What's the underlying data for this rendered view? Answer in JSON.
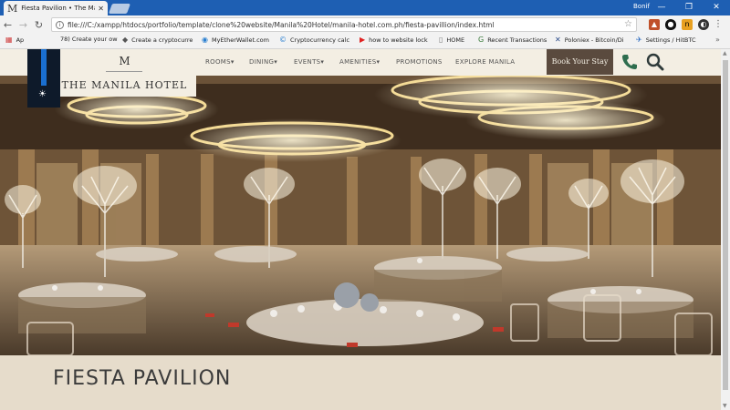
{
  "browser": {
    "tab_title": "Fiesta Pavilion • The Mani",
    "tab_favicon": "M",
    "profile_name": "Bonif",
    "url": "file:///C:/xampp/htdocs/portfolio/template/clone%20website/Manila%20Hotel/manila-hotel.com.ph/fiesta-pavillion/index.html",
    "bookmarks": [
      {
        "icon": "apps-grid-icon",
        "label": "Ap"
      },
      {
        "icon": "page-icon",
        "label": "78) Create your ow"
      },
      {
        "icon": "ethereum-icon",
        "label": "Create a cryptocurre"
      },
      {
        "icon": "myetherwallet-icon",
        "label": "MyEtherWallet.com"
      },
      {
        "icon": "calculator-icon",
        "label": "Cryptocurrency calc"
      },
      {
        "icon": "youtube-icon",
        "label": "how to website lock"
      },
      {
        "icon": "page-icon",
        "label": "HOME"
      },
      {
        "icon": "google-icon",
        "label": "Recent Transactions"
      },
      {
        "icon": "poloniex-icon",
        "label": "Poloniex - Bitcoin/Di"
      },
      {
        "icon": "hitbtc-icon",
        "label": "Settings / HitBTC"
      }
    ]
  },
  "site": {
    "logo_letter": "M",
    "logo_name": "THE MANILA HOTEL",
    "nav": [
      {
        "label": "ROOMS",
        "has_dropdown": true
      },
      {
        "label": "DINING",
        "has_dropdown": true
      },
      {
        "label": "EVENTS",
        "has_dropdown": true
      },
      {
        "label": "AMENITIES",
        "has_dropdown": true
      },
      {
        "label": "PROMOTIONS",
        "has_dropdown": false
      },
      {
        "label": "EXPLORE MANILA",
        "has_dropdown": false
      }
    ],
    "book_label": "Book Your Stay",
    "dropdown_caret": "▾",
    "brand_color": "#5a4a3e",
    "header_bg": "#f3eee3",
    "page_title": "FIESTA PAVILION",
    "brightness_level": 0.85
  }
}
